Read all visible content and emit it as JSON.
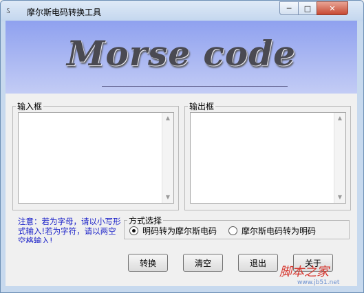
{
  "window": {
    "title": "摩尔斯电码转换工具",
    "app_icon": "ઽ",
    "controls": {
      "minimize": "─",
      "maximize": "□",
      "close": "✕"
    }
  },
  "banner": {
    "text": "Morse code"
  },
  "input_box": {
    "label": "输入框",
    "value": ""
  },
  "output_box": {
    "label": "输出框",
    "value": ""
  },
  "scroll": {
    "up": "▲",
    "down": "▼"
  },
  "note": "注意：若为字母，请以小写形式输入!若为字符，请以两空空格输入!",
  "mode": {
    "label": "方式选择",
    "options": [
      {
        "label": "明码转为摩尔斯电码",
        "selected": true
      },
      {
        "label": "摩尔斯电码转为明码",
        "selected": false
      }
    ]
  },
  "buttons": {
    "convert": "转换",
    "clear": "清空",
    "exit": "退出",
    "about": "关于"
  },
  "watermark": {
    "text": "脚本之家",
    "url": "www.jb51.net"
  }
}
